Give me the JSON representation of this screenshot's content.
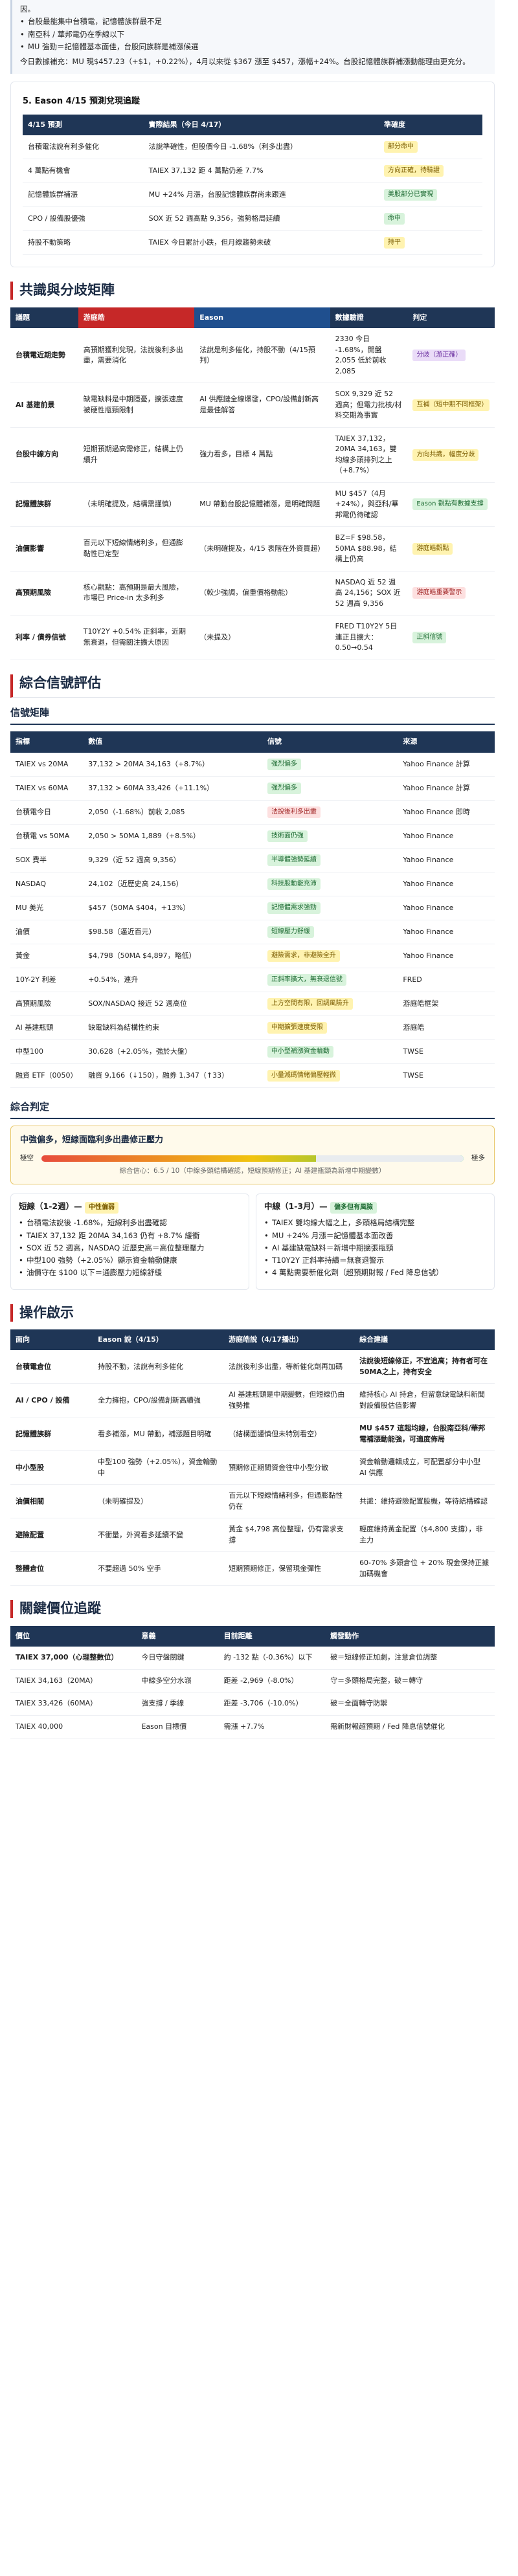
{
  "intro": {
    "partial": "因。",
    "bullets": [
      "台股最能集中台積電，記憶體族群最不足",
      "南亞科 / 華邦電仍在季線以下",
      "MU 強勁＝記憶體基本面佳，台股同族群是補漲候選"
    ],
    "para": "今日數據補充：MU 現$457.23（+$1，+0.22%），4月以來從 $367 漲至 $457，漲幅+24%。台股記憶體族群補漲動能理由更充分。"
  },
  "forecast": {
    "title": "5. Eason 4/15 預測兌現追蹤",
    "headers": [
      "4/15 預測",
      "實際結果（今日 4/17）",
      "準確度"
    ],
    "rows": [
      {
        "pred": "台積電法說有利多催化",
        "result": "法說準確性，但股價今日 -1.68%（利多出盡）",
        "badge": "部分命中",
        "color": "b-yellow"
      },
      {
        "pred": "4 萬點有機會",
        "result": "TAIEX 37,132 距 4 萬點仍差 7.7%",
        "badge": "方向正確，待驗證",
        "color": "b-yellow"
      },
      {
        "pred": "記憶體族群補漲",
        "result": "MU +24% 月漲，台股記憶體族群尚未跟進",
        "badge": "美股部分已實現",
        "color": "b-green"
      },
      {
        "pred": "CPO / 設備股優強",
        "result": "SOX 近 52 週高點 9,356，強勢格局延續",
        "badge": "命中",
        "color": "b-green"
      },
      {
        "pred": "持股不動策略",
        "result": "TAIEX 今日累計小跌，但月線趨勢未破",
        "badge": "持平",
        "color": "b-yellow"
      }
    ]
  },
  "matrix": {
    "title": "共識與分歧矩陣",
    "headers": [
      "議題",
      "游庭皓",
      "Eason",
      "數據驗證",
      "判定"
    ],
    "rows": [
      {
        "topic": "台積電近期走勢",
        "you": "高預期獲利兌現，法說後利多出盡，需要消化",
        "eason": "法說是利多催化，持股不動（4/15預判）",
        "data": "2330 今日 -1.68%，開盤 2,055 低於前收 2,085",
        "badge": "分歧（游正確）",
        "color": "b-purple"
      },
      {
        "topic": "AI 基建前景",
        "you": "缺電缺料是中期隱憂，擴張速度被硬性瓶頸限制",
        "eason": "AI 供應鏈全線爆發，CPO/設備創新高是最佳解答",
        "data": "SOX 9,329 近 52 週高；但電力批核/材料交期為事實",
        "badge": "互補（短中期不同框架）",
        "color": "b-yellow"
      },
      {
        "topic": "台股中線方向",
        "you": "短期預期過高需修正，結構上仍續升",
        "eason": "強力看多，目標 4 萬點",
        "data": "TAIEX 37,132，20MA 34,163，雙均線多頭排列之上（+8.7%）",
        "badge": "方向共識，幅度分歧",
        "color": "b-yellow"
      },
      {
        "topic": "記憶體族群",
        "you": "（未明確提及，結構需謹慎）",
        "eason": "MU 帶動台股記憶體補漲，是明確問題",
        "data": "MU $457（4月+24%），與亞科/華邦電仍待確認",
        "badge": "Eason 觀點有數據支撐",
        "color": "b-green"
      },
      {
        "topic": "油價影響",
        "you": "百元以下短線情緒利多，但通膨黏性已定型",
        "eason": "（未明確提及，4/15 表階在外資買超）",
        "data": "BZ=F $98.58，50MA $88.98，結構上仍高",
        "badge": "游庭皓觀點",
        "color": "b-yellow"
      },
      {
        "topic": "高預期風險",
        "you": "核心觀點：高預期是最大風險，市場已 Price-in 太多利多",
        "eason": "（較少強調，偏重價格動能）",
        "data": "NASDAQ 近 52 週高 24,156；SOX 近 52 週高 9,356",
        "badge": "游庭皓重要警示",
        "color": "b-red"
      },
      {
        "topic": "利率 / 債券信號",
        "you": "T10Y2Y +0.54% 正斜率，近期無衰退，但需關注擴大原因",
        "eason": "（未提及）",
        "data": "FRED T10Y2Y 5日連正且擴大：0.50→0.54",
        "badge": "正斜信號",
        "color": "b-green"
      }
    ]
  },
  "signals": {
    "title": "綜合信號評估",
    "subtitle": "信號矩陣",
    "headers": [
      "指標",
      "數值",
      "信號",
      "來源"
    ],
    "rows": [
      {
        "name": "TAIEX vs 20MA",
        "value": "37,132 > 20MA 34,163（+8.7%）",
        "badge": "強烈偏多",
        "color": "b-green",
        "src": "Yahoo Finance 計算"
      },
      {
        "name": "TAIEX vs 60MA",
        "value": "37,132 > 60MA 33,426（+11.1%）",
        "badge": "強烈偏多",
        "color": "b-green",
        "src": "Yahoo Finance 計算"
      },
      {
        "name": "台積電今日",
        "value": "2,050（-1.68%）前收 2,085",
        "badge": "法說後利多出盡",
        "color": "b-red",
        "src": "Yahoo Finance 即時"
      },
      {
        "name": "台積電 vs 50MA",
        "value": "2,050 > 50MA 1,889（+8.5%）",
        "badge": "技術面仍強",
        "color": "b-green",
        "src": "Yahoo Finance"
      },
      {
        "name": "SOX 費半",
        "value": "9,329（近 52 週高 9,356）",
        "badge": "半導體強勢延續",
        "color": "b-green",
        "src": "Yahoo Finance"
      },
      {
        "name": "NASDAQ",
        "value": "24,102（近歷史高 24,156）",
        "badge": "科技股動能充沛",
        "color": "b-green",
        "src": "Yahoo Finance"
      },
      {
        "name": "MU 美光",
        "value": "$457（50MA $404，+13%）",
        "badge": "記憶體需求強勁",
        "color": "b-green",
        "src": "Yahoo Finance"
      },
      {
        "name": "油價",
        "value": "$98.58（逼近百元）",
        "badge": "短線壓力舒緩",
        "color": "b-green",
        "src": "Yahoo Finance"
      },
      {
        "name": "黃金",
        "value": "$4,798（50MA $4,897，略低）",
        "badge": "避險需求，非避險全升",
        "color": "b-yellow",
        "src": "Yahoo Finance"
      },
      {
        "name": "10Y-2Y 利差",
        "value": "+0.54%，連升",
        "badge": "正斜率擴大，無衰退信號",
        "color": "b-green",
        "src": "FRED"
      },
      {
        "name": "高預期風險",
        "value": "SOX/NASDAQ 接近 52 週高位",
        "badge": "上方空間有限，回調風險升",
        "color": "b-yellow",
        "src": "游庭皓框架"
      },
      {
        "name": "AI 基建瓶頸",
        "value": "缺電缺料為結構性約束",
        "badge": "中期擴張速度受限",
        "color": "b-yellow",
        "src": "游庭皓"
      },
      {
        "name": "中型100",
        "value": "30,628（+2.05%，強於大盤）",
        "badge": "中小型補漲資金輪動",
        "color": "b-green",
        "src": "TWSE"
      },
      {
        "name": "融資 ETF（0050）",
        "value": "融資 9,166（↓150），融券 1,347（↑33）",
        "badge": "小量減碼情緒偏壓輕微",
        "color": "b-yellow",
        "src": "TWSE"
      }
    ]
  },
  "judgement": {
    "title": "綜合判定",
    "verdict": "中強偏多，短線面臨利多出盡修正壓力",
    "left_label": "極空",
    "right_label": "極多",
    "score": 0.65,
    "caption": "綜合信心：6.5 / 10（中線多頭結構確認，短線預期修正；AI 基建瓶頸為新增中期變數）",
    "short": {
      "title": "短線（1-2週）—",
      "badge": "中性偏弱",
      "items": [
        "台積電法說後 -1.68%，短線利多出盡確認",
        "TAIEX 37,132 距 20MA 34,163 仍有 +8.7% 緩衝",
        "SOX 近 52 週高，NASDAQ 近歷史高＝高位整理壓力",
        "中型100 強勢（+2.05%）顯示資金輪動健康",
        "油價守在 $100 以下＝通膨壓力短線舒緩"
      ]
    },
    "mid": {
      "title": "中線（1-3月）—",
      "badge": "偏多但有風險",
      "items": [
        "TAIEX 雙均線大幅之上，多頭格局結構完整",
        "MU +24% 月漲＝記憶體基本面改善",
        "AI 基建缺電缺料＝新增中期擴張瓶頸",
        "T10Y2Y 正斜率持續＝無衰退警示",
        "4 萬點需要新催化劑（超預期財報 / Fed 降息信號）"
      ]
    }
  },
  "actions": {
    "title": "操作啟示",
    "headers": [
      "面向",
      "Eason 說（4/15）",
      "游庭皓說（4/17播出）",
      "綜合建議"
    ],
    "rows": [
      {
        "topic": "台積電倉位",
        "eason": "持股不動，法說有利多催化",
        "you": "法說後利多出盡，等新催化劑再加碼",
        "advice": "法說後短線修正，不宜追高；持有者可在50MA之上，持有安全",
        "bold": true
      },
      {
        "topic": "AI / CPO / 設備",
        "eason": "全力擁抱，CPO/設備創新高續強",
        "you": "AI 基建瓶頸是中期變數，但短線仍由強勢推",
        "advice": "維持核心 AI 持倉，但留意缺電缺料新聞對設備股估值影響",
        "bold": false
      },
      {
        "topic": "記憶體族群",
        "eason": "看多補漲，MU 帶動，補漲題目明確",
        "you": "（結構面謹慎但未特別看空）",
        "advice": "MU $457 這超均線，台股南亞科/華邦電補漲動能強，可適度佈局",
        "bold": true
      },
      {
        "topic": "中小型股",
        "eason": "中型100 強勢（+2.05%），資金輪動中",
        "you": "預期修正期間資金往中小型分散",
        "advice": "資金輪動邏輯成立，可配置部分中小型 AI 供應",
        "bold": false
      },
      {
        "topic": "油價相關",
        "eason": "（未明確提及）",
        "you": "百元以下短線情緒利多，但通膨黏性仍在",
        "advice": "共識：維持避險配置股機，等待結構確認",
        "bold": false
      },
      {
        "topic": "避險配置",
        "eason": "不衝量，外資看多延續不變",
        "you": "黃金 $4,798 高位整理，仍有需求支撐",
        "advice": "輕度維持黃金配置（$4,800 支撐），非主力",
        "bold": false
      },
      {
        "topic": "整體倉位",
        "eason": "不要超過 50% 空手",
        "you": "短期預期修正，保留現金彈性",
        "advice": "60-70% 多頭倉位 + 20% 現金保持正據加碼機會",
        "bold": false
      }
    ]
  },
  "levels": {
    "title": "關鍵價位追蹤",
    "headers": [
      "價位",
      "意義",
      "目前距離",
      "觸發動作"
    ],
    "rows": [
      {
        "level": "TAIEX 37,000（心理整數位）",
        "meaning": "今日守盤關鍵",
        "dist": "約 -132 點（-0.36%）以下",
        "action": "破＝短線修正加劇，注意倉位調整",
        "bold": true
      },
      {
        "level": "TAIEX 34,163（20MA）",
        "meaning": "中線多空分水嶺",
        "dist": "距差 -2,969（-8.0%）",
        "action": "守＝多頭格局完整，破＝轉守",
        "bold": false
      },
      {
        "level": "TAIEX 33,426（60MA）",
        "meaning": "強支撐 / 季線",
        "dist": "距差 -3,706（-10.0%）",
        "action": "破＝全面轉守防禦",
        "bold": false
      },
      {
        "level": "TAIEX 40,000",
        "meaning": "Eason 目標價",
        "dist": "需漲 +7.7%",
        "action": "需新財報超預期 / Fed 降息信號催化",
        "bold": false
      }
    ]
  }
}
